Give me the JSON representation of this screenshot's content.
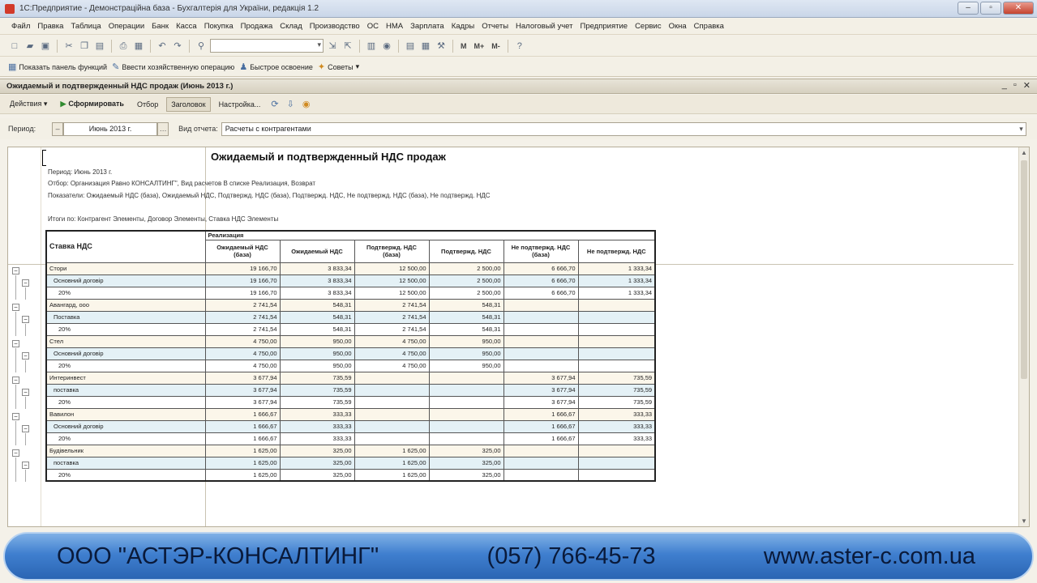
{
  "window": {
    "title": "1С:Предприятие - Демонстраційна база - Бухгалтерія для України, редакція 1.2",
    "buttons": [
      "–",
      "▫",
      "✕"
    ]
  },
  "menu": [
    "Файл",
    "Правка",
    "Таблица",
    "Операции",
    "Банк",
    "Касса",
    "Покупка",
    "Продажа",
    "Склад",
    "Производство",
    "ОС",
    "НМА",
    "Зарплата",
    "Кадры",
    "Отчеты",
    "Налоговый учет",
    "Предприятие",
    "Сервис",
    "Окна",
    "Справка"
  ],
  "toolbar2": {
    "show_panel": "Показать панель функций",
    "enter_op": "Ввести хозяйственную операцию",
    "quick_start": "Быстрое освоение",
    "tips": "Советы"
  },
  "document": {
    "title": "Ожидаемый и подтвержденный НДС продаж (Июнь 2013 г.)"
  },
  "actions": {
    "actions": "Действия ▾",
    "generate": "Сформировать",
    "filter": "Отбор",
    "header": "Заголовок",
    "settings": "Настройка..."
  },
  "period": {
    "label": "Период:",
    "value": "Июнь 2013 г.",
    "report_type_label": "Вид отчета:",
    "report_type": "Расчеты с контрагентами"
  },
  "report": {
    "title": "Ожидаемый и подтвержденный НДС продаж",
    "period_line": "Период: Июнь 2013 г.",
    "filter_line": "Отбор: Организация Равно КОНСАЛТИНГ\", Вид расчетов В списке Реализация, Возврат",
    "indicators_line": "Показатели: Ожидаемый НДС (база), Ожидаемый НДС, Подтвержд. НДС (база), Подтвержд. НДС, Не подтвержд. НДС (база), Не подтвержд. НДС",
    "totals_line": "Итоги по: Контрагент Элементы, Договор Элементы, Ставка НДС Элементы",
    "col_rate": "Ставка НДС",
    "group_header": "Реализация",
    "columns": [
      "Ожидаемый НДС (база)",
      "Ожидаемый НДС",
      "Подтвержд. НДС (база)",
      "Подтвержд. НДС",
      "Не подтвержд. НДС (база)",
      "Не подтвержд. НДС"
    ],
    "rows": [
      {
        "level": 0,
        "name": "Стори",
        "v": [
          "19 166,70",
          "3 833,34",
          "12 500,00",
          "2 500,00",
          "6 666,70",
          "1 333,34"
        ]
      },
      {
        "level": 1,
        "name": "Основний договір",
        "v": [
          "19 166,70",
          "3 833,34",
          "12 500,00",
          "2 500,00",
          "6 666,70",
          "1 333,34"
        ]
      },
      {
        "level": 2,
        "name": "20%",
        "v": [
          "19 166,70",
          "3 833,34",
          "12 500,00",
          "2 500,00",
          "6 666,70",
          "1 333,34"
        ]
      },
      {
        "level": 0,
        "name": "Авангард, ооо",
        "v": [
          "2 741,54",
          "548,31",
          "2 741,54",
          "548,31",
          "",
          ""
        ]
      },
      {
        "level": 1,
        "name": "Поставка",
        "v": [
          "2 741,54",
          "548,31",
          "2 741,54",
          "548,31",
          "",
          ""
        ]
      },
      {
        "level": 2,
        "name": "20%",
        "v": [
          "2 741,54",
          "548,31",
          "2 741,54",
          "548,31",
          "",
          ""
        ]
      },
      {
        "level": 0,
        "name": "Стел",
        "v": [
          "4 750,00",
          "950,00",
          "4 750,00",
          "950,00",
          "",
          ""
        ]
      },
      {
        "level": 1,
        "name": "Основний договір",
        "v": [
          "4 750,00",
          "950,00",
          "4 750,00",
          "950,00",
          "",
          ""
        ]
      },
      {
        "level": 2,
        "name": "20%",
        "v": [
          "4 750,00",
          "950,00",
          "4 750,00",
          "950,00",
          "",
          ""
        ]
      },
      {
        "level": 0,
        "name": "Интеринвест",
        "v": [
          "3 677,94",
          "735,59",
          "",
          "",
          "3 677,94",
          "735,59"
        ]
      },
      {
        "level": 1,
        "name": "поставка",
        "v": [
          "3 677,94",
          "735,59",
          "",
          "",
          "3 677,94",
          "735,59"
        ]
      },
      {
        "level": 2,
        "name": "20%",
        "v": [
          "3 677,94",
          "735,59",
          "",
          "",
          "3 677,94",
          "735,59"
        ]
      },
      {
        "level": 0,
        "name": "Вавилон",
        "v": [
          "1 666,67",
          "333,33",
          "",
          "",
          "1 666,67",
          "333,33"
        ]
      },
      {
        "level": 1,
        "name": "Основний договір",
        "v": [
          "1 666,67",
          "333,33",
          "",
          "",
          "1 666,67",
          "333,33"
        ]
      },
      {
        "level": 2,
        "name": "20%",
        "v": [
          "1 666,67",
          "333,33",
          "",
          "",
          "1 666,67",
          "333,33"
        ]
      },
      {
        "level": 0,
        "name": "Будівельник",
        "v": [
          "1 625,00",
          "325,00",
          "1 625,00",
          "325,00",
          "",
          ""
        ]
      },
      {
        "level": 1,
        "name": "поставка",
        "v": [
          "1 625,00",
          "325,00",
          "1 625,00",
          "325,00",
          "",
          ""
        ]
      },
      {
        "level": 2,
        "name": "20%",
        "v": [
          "1 625,00",
          "325,00",
          "1 625,00",
          "325,00",
          "",
          ""
        ]
      }
    ]
  },
  "footer": {
    "company": "ООО \"АСТЭР-КОНСАЛТИНГ\"",
    "phone": "(057) 766-45-73",
    "site": "www.aster-c.com.ua"
  },
  "colors": {
    "footer_blue": "#3f7fcf",
    "row_group": "#fbf6ea",
    "row_contract": "#e4f1f6"
  }
}
